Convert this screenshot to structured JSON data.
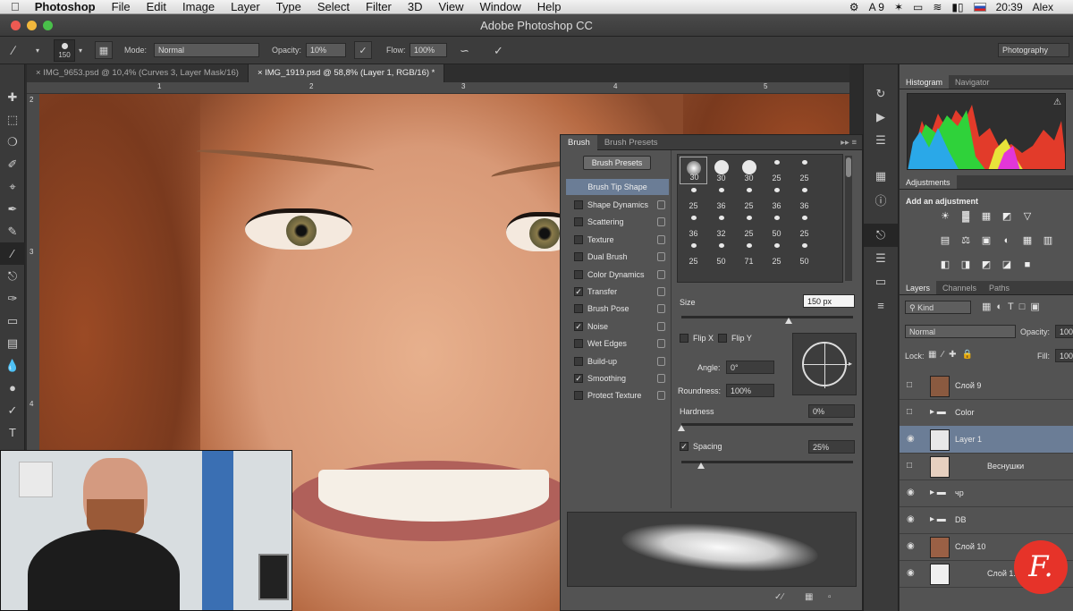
{
  "menubar": {
    "app": "Photoshop",
    "items": [
      "File",
      "Edit",
      "Image",
      "Layer",
      "Type",
      "Select",
      "Filter",
      "3D",
      "View",
      "Window",
      "Help"
    ],
    "input_indicator": "9",
    "time": "20:39",
    "user": "Alex"
  },
  "titlebar": {
    "title": "Adobe Photoshop CC"
  },
  "options": {
    "brush_size": "150",
    "mode_label": "Mode:",
    "mode_value": "Normal",
    "opacity_label": "Opacity:",
    "opacity_value": "10%",
    "flow_label": "Flow:",
    "flow_value": "100%",
    "workspace": "Photography"
  },
  "doctabs": [
    {
      "label": "IMG_9653.psd @ 10,4% (Curves 3, Layer Mask/16)"
    },
    {
      "label": "IMG_1919.psd @ 58,8% (Layer 1, RGB/16) *"
    }
  ],
  "ruler": {
    "marks": [
      "1",
      "2",
      "3",
      "4",
      "5"
    ],
    "left_marks": [
      "2",
      "3",
      "4"
    ]
  },
  "brush_panel": {
    "tabs": [
      "Brush",
      "Brush Presets"
    ],
    "presets_button": "Brush Presets",
    "tip_shape": "Brush Tip Shape",
    "options": [
      {
        "label": "Shape Dynamics",
        "checked": false
      },
      {
        "label": "Scattering",
        "checked": false
      },
      {
        "label": "Texture",
        "checked": false
      },
      {
        "label": "Dual Brush",
        "checked": false
      },
      {
        "label": "Color Dynamics",
        "checked": false
      },
      {
        "label": "Transfer",
        "checked": true
      },
      {
        "label": "Brush Pose",
        "checked": false
      },
      {
        "label": "Noise",
        "checked": true
      },
      {
        "label": "Wet Edges",
        "checked": false
      },
      {
        "label": "Build-up",
        "checked": false
      },
      {
        "label": "Smoothing",
        "checked": true
      },
      {
        "label": "Protect Texture",
        "checked": false
      }
    ],
    "tips": [
      "30",
      "30",
      "30",
      "25",
      "25",
      "25",
      "36",
      "25",
      "36",
      "36",
      "36",
      "32",
      "25",
      "50",
      "25",
      "25",
      "50",
      "71",
      "25",
      "50"
    ],
    "size_label": "Size",
    "size_value": "150 px",
    "flipx": "Flip X",
    "flipy": "Flip Y",
    "angle_label": "Angle:",
    "angle_value": "0°",
    "roundness_label": "Roundness:",
    "roundness_value": "100%",
    "hardness_label": "Hardness",
    "hardness_value": "0%",
    "spacing_label": "Spacing",
    "spacing_value": "25%"
  },
  "histogram": {
    "tabs": [
      "Histogram",
      "Navigator"
    ]
  },
  "adjustments": {
    "tab": "Adjustments",
    "heading": "Add an adjustment"
  },
  "layers": {
    "tabs": [
      "Layers",
      "Channels",
      "Paths"
    ],
    "filter_value": "Kind",
    "blend_value": "Normal",
    "opacity_label": "Opacity:",
    "opacity_value": "100",
    "lock_label": "Lock:",
    "fill_label": "Fill:",
    "fill_value": "100",
    "items": [
      {
        "name": "Слой 9",
        "visible": false
      },
      {
        "name": "Color",
        "visible": false
      },
      {
        "name": "Layer 1",
        "visible": true,
        "selected": true
      },
      {
        "name": "Веснушки",
        "visible": false
      },
      {
        "name": "чр",
        "visible": true
      },
      {
        "name": "DB",
        "visible": true
      },
      {
        "name": "Слой 10",
        "visible": true
      },
      {
        "name": "Слой 1...",
        "visible": true
      }
    ]
  },
  "logo": {
    "text": "F."
  },
  "colors": {
    "selection": "#6b7d96",
    "panel": "#535353",
    "logo": "#e63329"
  }
}
